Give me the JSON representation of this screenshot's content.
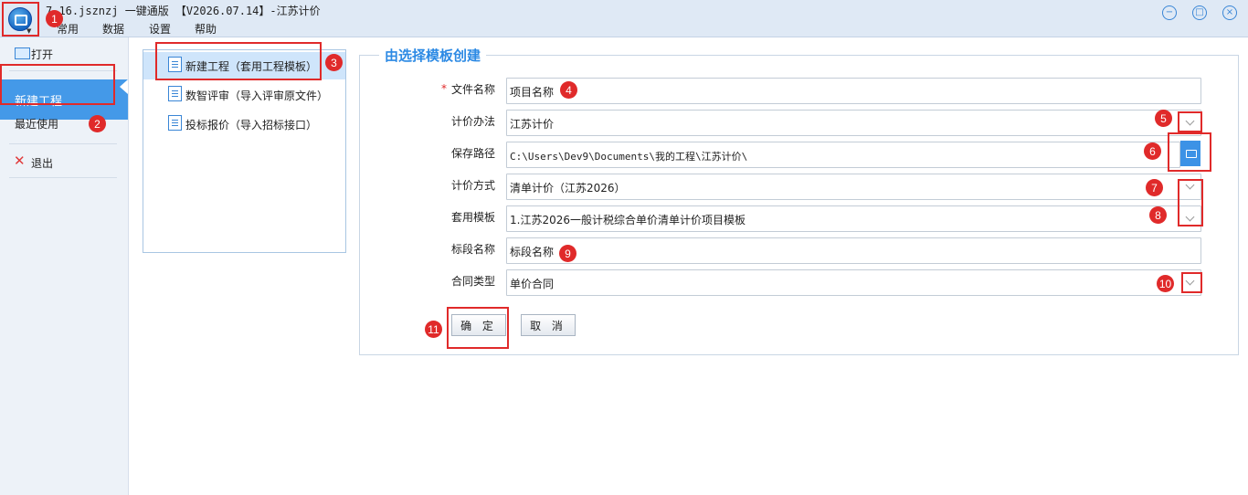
{
  "window": {
    "title": "7.16.jsznzj 一键通版 【V2026.07.14】-江苏计价",
    "menu": [
      "常用",
      "数据",
      "设置",
      "帮助"
    ]
  },
  "leftnav": {
    "items": [
      {
        "label": "打开",
        "icon": "folder-icon"
      },
      {
        "label": "新建工程",
        "selected": true
      },
      {
        "label": "最近使用"
      },
      {
        "label": "退出",
        "icon": "close-x-icon"
      }
    ]
  },
  "midpanel": {
    "items": [
      {
        "label": "新建工程（套用工程模板）",
        "selected": true,
        "icon": "document-icon"
      },
      {
        "label": "数智评审（导入评审原文件）",
        "icon": "document-icon"
      },
      {
        "label": "投标报价（导入招标接口）",
        "icon": "chart-document-icon"
      }
    ]
  },
  "form": {
    "title": "由选择模板创建",
    "required_marker": "*",
    "fields": [
      {
        "label": "文件名称",
        "value": "项目名称",
        "required": true
      },
      {
        "label": "计价办法",
        "value": "江苏计价"
      },
      {
        "label": "保存路径",
        "value": "C:\\Users\\Dev9\\Documents\\我的工程\\江苏计价\\"
      },
      {
        "label": "计价方式",
        "value": "清单计价（江苏2026）"
      },
      {
        "label": "套用模板",
        "value": "1.江苏2026一般计税综合单价清单计价项目模板"
      },
      {
        "label": "标段名称",
        "value": "标段名称"
      },
      {
        "label": "合同类型",
        "value": "单价合同"
      }
    ],
    "confirm_label": "确 定",
    "cancel_label": "取 消"
  },
  "annotations": [
    "1",
    "2",
    "3",
    "4",
    "5",
    "6",
    "7",
    "8",
    "9",
    "10",
    "11"
  ],
  "colors": {
    "accent": "#4499e8",
    "annotation": "#e02a2a",
    "title_blue": "#2d8ae4"
  }
}
